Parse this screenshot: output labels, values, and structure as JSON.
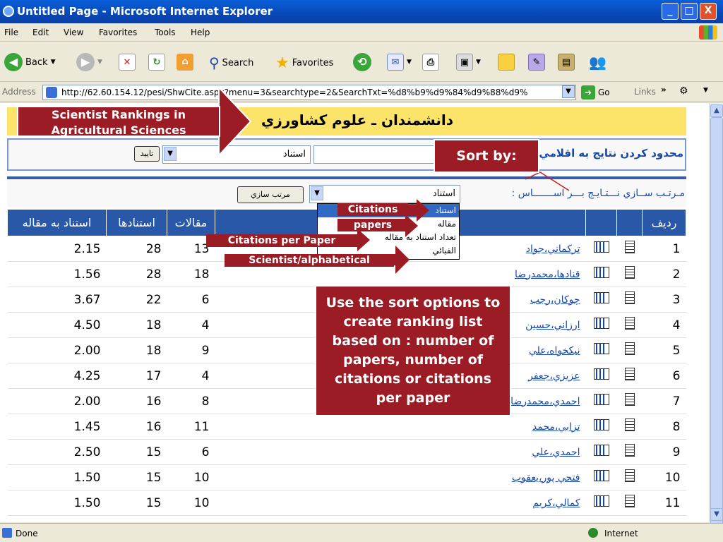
{
  "window": {
    "title": "Untitled Page - Microsoft Internet Explorer",
    "minimize_label": "_",
    "maximize_label": "□",
    "close_label": "X"
  },
  "menu": [
    "File",
    "Edit",
    "View",
    "Favorites",
    "Tools",
    "Help"
  ],
  "toolbar": {
    "back_label": "Back",
    "search_label": "Search",
    "favorites_label": "Favorites"
  },
  "address": {
    "label": "Address",
    "url": "http://62.60.154.12/pesi/ShwCite.aspx?menu=3&searchtype=2&SearchTxt=%d8%b9%d9%84%d9%88%d9%",
    "go_label": "Go",
    "links_label": "Links"
  },
  "page": {
    "banner_title": "دانشمندان ـ علوم كشاورزي",
    "filter_title": "محدود كردن نتايج به اقلامي",
    "filter_select_value": "استناد",
    "filter_button_label": "تاييد",
    "sort_label": "مـرتـب ســازي نـــتـايـج بـــر اســـــــاس :",
    "sort_select_value": "استناد",
    "sort_button_label": "مرتب سازي",
    "sort_options": [
      "استناد",
      "مقاله",
      "تعداد استناد به مقاله",
      "الفبائي"
    ],
    "sort_selected_index": 0
  },
  "table": {
    "headers": {
      "row": "رديف",
      "papers": "مقالات",
      "citations": "استنادها",
      "ratio": "استناد به مقاله"
    },
    "rows": [
      {
        "n": "1",
        "name": "تركماني،جواد",
        "papers": "13",
        "citations": "28",
        "ratio": "2.15"
      },
      {
        "n": "2",
        "name": "قنادها،محمدرضا",
        "papers": "18",
        "citations": "28",
        "ratio": "1.56"
      },
      {
        "n": "3",
        "name": "چوكان،رجب",
        "papers": "6",
        "citations": "22",
        "ratio": "3.67"
      },
      {
        "n": "4",
        "name": "ارزاني،حسين",
        "papers": "4",
        "citations": "18",
        "ratio": "4.50"
      },
      {
        "n": "5",
        "name": "نيكخواه،علي",
        "papers": "9",
        "citations": "18",
        "ratio": "2.00"
      },
      {
        "n": "6",
        "name": "عزيزي،جعفر",
        "papers": "4",
        "citations": "17",
        "ratio": "4.25"
      },
      {
        "n": "7",
        "name": "احمدي،محمدرضا",
        "papers": "8",
        "citations": "16",
        "ratio": "2.00"
      },
      {
        "n": "8",
        "name": "تزابي،محمد",
        "papers": "11",
        "citations": "16",
        "ratio": "1.45"
      },
      {
        "n": "9",
        "name": "احمدي،علي",
        "papers": "6",
        "citations": "15",
        "ratio": "2.50"
      },
      {
        "n": "10",
        "name": "فتحي پور،يعقوب",
        "papers": "10",
        "citations": "15",
        "ratio": "1.50"
      },
      {
        "n": "11",
        "name": "كمالي،كريم",
        "papers": "10",
        "citations": "15",
        "ratio": "1.50"
      }
    ]
  },
  "annotations": {
    "title_box": "Scientist Rankings in Agricultural Sciences",
    "sort_by": "Sort by:",
    "citations": "Citations",
    "papers": "papers",
    "citations_per_paper": "Citations per Paper",
    "alphabetical": "Scientist/alphabetical",
    "explain": "Use the sort options to create  ranking list based on : number of papers, number of citations or citations per paper"
  },
  "status": {
    "text": "Done",
    "zone": "Internet"
  },
  "colors": {
    "accent": "#9b1c24",
    "header": "#2a58a8",
    "banner": "#fce36a"
  }
}
